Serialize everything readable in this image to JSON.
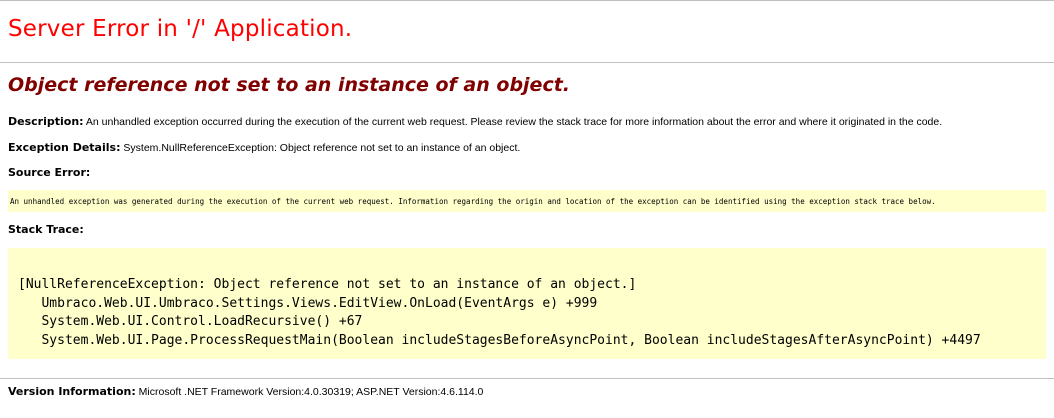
{
  "page": {
    "app_title": "Server Error in '/' Application.",
    "error_message": "Object reference not set to an instance of an object."
  },
  "description": {
    "label": "Description:",
    "text": "An unhandled exception occurred during the execution of the current web request. Please review the stack trace for more information about the error and where it originated in the code."
  },
  "exception_details": {
    "label": "Exception Details:",
    "text": "System.NullReferenceException: Object reference not set to an instance of an object."
  },
  "source_error": {
    "label": "Source Error:",
    "text": "An unhandled exception was generated during the execution of the current web request. Information regarding the origin and location of the exception can be identified using the exception stack trace below."
  },
  "stack_trace": {
    "label": "Stack Trace:",
    "lines": [
      "[NullReferenceException: Object reference not set to an instance of an object.]",
      "   Umbraco.Web.UI.Umbraco.Settings.Views.EditView.OnLoad(EventArgs e) +999",
      "   System.Web.UI.Control.LoadRecursive() +67",
      "   System.Web.UI.Page.ProcessRequestMain(Boolean includeStagesBeforeAsyncPoint, Boolean includeStagesAfterAsyncPoint) +4497"
    ]
  },
  "version_info": {
    "label": "Version Information:",
    "text": "Microsoft .NET Framework Version:4.0.30319; ASP.NET Version:4.6.114.0"
  },
  "colors": {
    "title": "#ff0000",
    "error_message": "#800000",
    "code_background": "#ffffcc",
    "rule": "#c0c0c0"
  }
}
